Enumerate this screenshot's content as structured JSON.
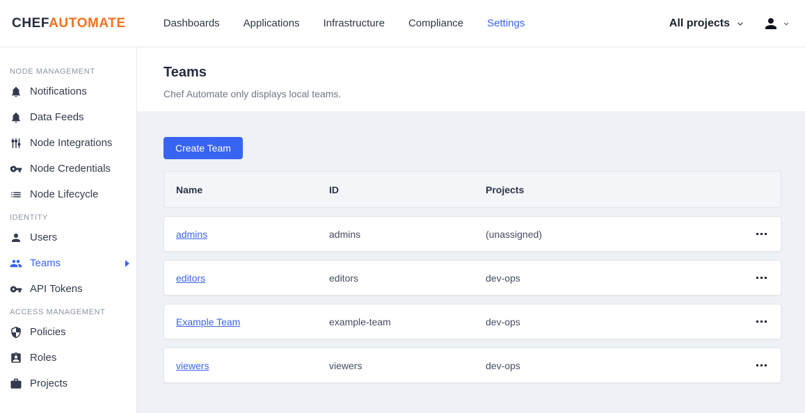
{
  "colors": {
    "accent_blue": "#3864f4",
    "brand_orange": "#f4701d",
    "content_bg": "#eef1f5"
  },
  "topnav": {
    "logo": {
      "part1": "CHEF",
      "part2": "AUTOMATE"
    },
    "links": [
      {
        "label": "Dashboards"
      },
      {
        "label": "Applications"
      },
      {
        "label": "Infrastructure"
      },
      {
        "label": "Compliance"
      },
      {
        "label": "Settings",
        "active": true
      }
    ],
    "projects_filter_label": "All projects",
    "icons": [
      "chevron-down-icon",
      "user-avatar-icon",
      "chevron-down-icon"
    ]
  },
  "sidebar": {
    "sections": [
      {
        "label": "NODE MANAGEMENT",
        "items": [
          {
            "label": "Notifications",
            "icon": "bell-icon"
          },
          {
            "label": "Data Feeds",
            "icon": "bell-icon"
          },
          {
            "label": "Node Integrations",
            "icon": "sliders-icon"
          },
          {
            "label": "Node Credentials",
            "icon": "key-icon"
          },
          {
            "label": "Node Lifecycle",
            "icon": "list-icon"
          }
        ]
      },
      {
        "label": "IDENTITY",
        "items": [
          {
            "label": "Users",
            "icon": "person-icon"
          },
          {
            "label": "Teams",
            "icon": "group-icon",
            "active": true
          },
          {
            "label": "API Tokens",
            "icon": "key-icon"
          }
        ]
      },
      {
        "label": "ACCESS MANAGEMENT",
        "items": [
          {
            "label": "Policies",
            "icon": "shield-icon"
          },
          {
            "label": "Roles",
            "icon": "badge-icon"
          },
          {
            "label": "Projects",
            "icon": "briefcase-icon"
          }
        ]
      }
    ]
  },
  "page": {
    "title": "Teams",
    "subtitle": "Chef Automate only displays local teams.",
    "create_button": "Create Team"
  },
  "table": {
    "columns": [
      "Name",
      "ID",
      "Projects"
    ],
    "rows": [
      {
        "name": "admins",
        "id": "admins",
        "projects": "(unassigned)"
      },
      {
        "name": "editors",
        "id": "editors",
        "projects": "dev-ops"
      },
      {
        "name": "Example Team",
        "id": "example-team",
        "projects": "dev-ops"
      },
      {
        "name": "viewers",
        "id": "viewers",
        "projects": "dev-ops"
      }
    ]
  }
}
